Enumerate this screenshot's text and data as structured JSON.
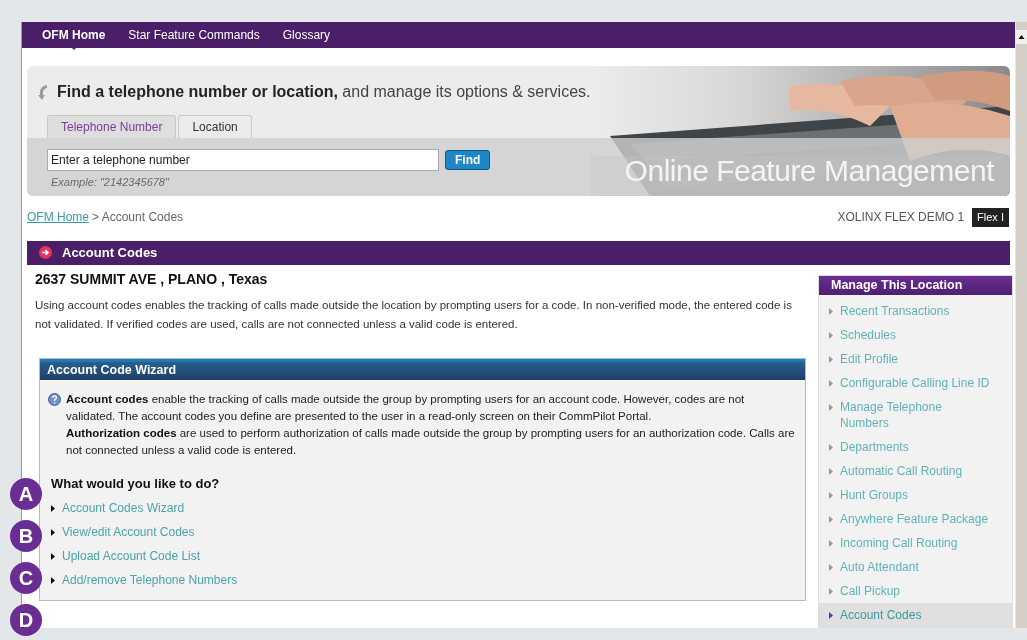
{
  "nav": [
    {
      "label": "OFM Home",
      "selected": true
    },
    {
      "label": "Star Feature Commands",
      "selected": false
    },
    {
      "label": "Glossary",
      "selected": false
    }
  ],
  "search": {
    "headline": "**Find a telephone number or location,** and manage its options & services.",
    "tabs": [
      {
        "label": "Telephone Number",
        "selected": true
      },
      {
        "label": "Location",
        "selected": false
      }
    ],
    "placeholder": "Enter a telephone number",
    "button": "Find",
    "example": "Example: \"2142345678\"",
    "banner_title": "Online Feature Management"
  },
  "breadcrumb": {
    "link": "OFM Home",
    "current": "> Account Codes"
  },
  "account": {
    "name": "XOLINX FLEX DEMO 1",
    "badge": "Flex I"
  },
  "section_title": "Account Codes",
  "address": "2637 SUMMIT AVE , PLANO , Texas",
  "description": "Using account codes enables the tracking of calls made outside the location by prompting users for a code. In non-verified mode, the entered code is not validated. If verified codes are used, calls are not connected unless a valid code is entered.",
  "wizard": {
    "title": "Account Code Wizard",
    "info": [
      "**Account codes** enable the tracking of calls made outside the group by prompting users for an account code. However, codes are not validated. The account codes you define are presented to the user in a read-only screen on their CommPilot Portal.",
      "**Authorization codes** are used to perform authorization of calls made outside the group by prompting users for an authorization code. Calls are not connected unless a valid code is entered."
    ],
    "question": "What would you like to do?",
    "links": [
      "Account Codes Wizard",
      "View/edit Account Codes",
      "Upload Account Code List",
      "Add/remove Telephone Numbers"
    ]
  },
  "sidebar": {
    "title": "Manage This Location",
    "items": [
      {
        "label": "Recent Transactions",
        "selected": false
      },
      {
        "label": "Schedules",
        "selected": false
      },
      {
        "label": "Edit Profile",
        "selected": false
      },
      {
        "label": "Configurable Calling Line ID",
        "selected": false
      },
      {
        "label": "Manage Telephone Numbers",
        "selected": false
      },
      {
        "label": "Departments",
        "selected": false
      },
      {
        "label": "Automatic Call Routing",
        "selected": false
      },
      {
        "label": "Hunt Groups",
        "selected": false
      },
      {
        "label": "Anywhere Feature Package",
        "selected": false
      },
      {
        "label": "Incoming Call Routing",
        "selected": false
      },
      {
        "label": "Auto Attendant",
        "selected": false
      },
      {
        "label": "Call Pickup",
        "selected": false
      },
      {
        "label": "Account Codes",
        "selected": true
      }
    ]
  },
  "markers": [
    "A",
    "B",
    "C",
    "D"
  ]
}
